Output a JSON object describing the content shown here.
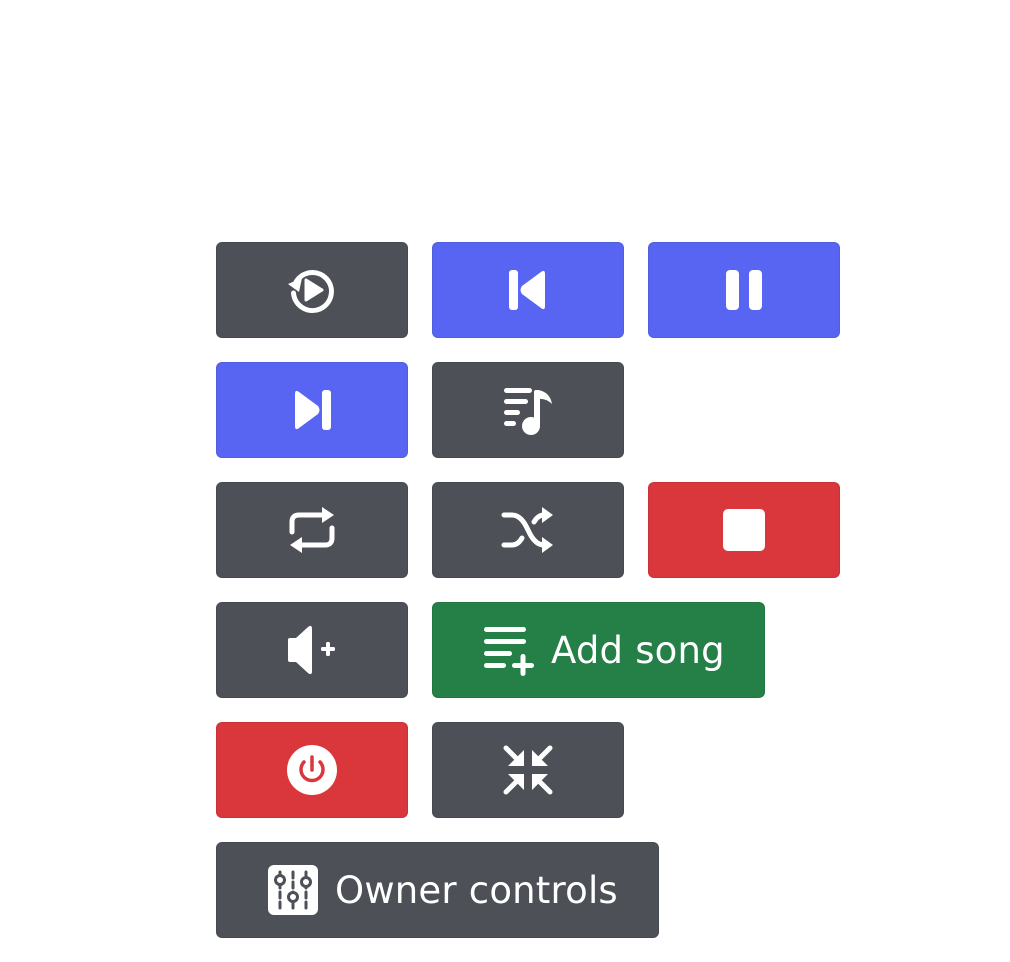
{
  "controls": {
    "row1": [
      {
        "name": "replay-button",
        "icon": "replay-icon",
        "style": "grey"
      },
      {
        "name": "previous-button",
        "icon": "skip-previous-icon",
        "style": "blurple"
      },
      {
        "name": "pause-button",
        "icon": "pause-icon",
        "style": "blurple"
      }
    ],
    "row2": [
      {
        "name": "skip-button",
        "icon": "skip-next-icon",
        "style": "blurple"
      },
      {
        "name": "queue-button",
        "icon": "playlist-music-icon",
        "style": "grey"
      }
    ],
    "row3": [
      {
        "name": "loop-button",
        "icon": "repeat-icon",
        "style": "grey"
      },
      {
        "name": "shuffle-button",
        "icon": "shuffle-icon",
        "style": "grey"
      },
      {
        "name": "stop-button",
        "icon": "stop-icon",
        "style": "red"
      }
    ],
    "row4": {
      "volume": {
        "icon": "volume-plus-icon",
        "style": "grey"
      },
      "add_song": {
        "label": "Add song",
        "icon": "playlist-add-icon",
        "style": "green"
      }
    },
    "row5": [
      {
        "name": "disconnect-button",
        "icon": "power-icon",
        "style": "red"
      },
      {
        "name": "minimize-button",
        "icon": "collapse-icon",
        "style": "grey"
      }
    ],
    "row6": {
      "owner_controls": {
        "label": "Owner controls",
        "icon": "equalizer-sliders-icon",
        "style": "grey"
      }
    }
  },
  "colors": {
    "grey": "#4e5058",
    "blurple": "#5865f2",
    "red": "#da373c",
    "green": "#248046"
  }
}
